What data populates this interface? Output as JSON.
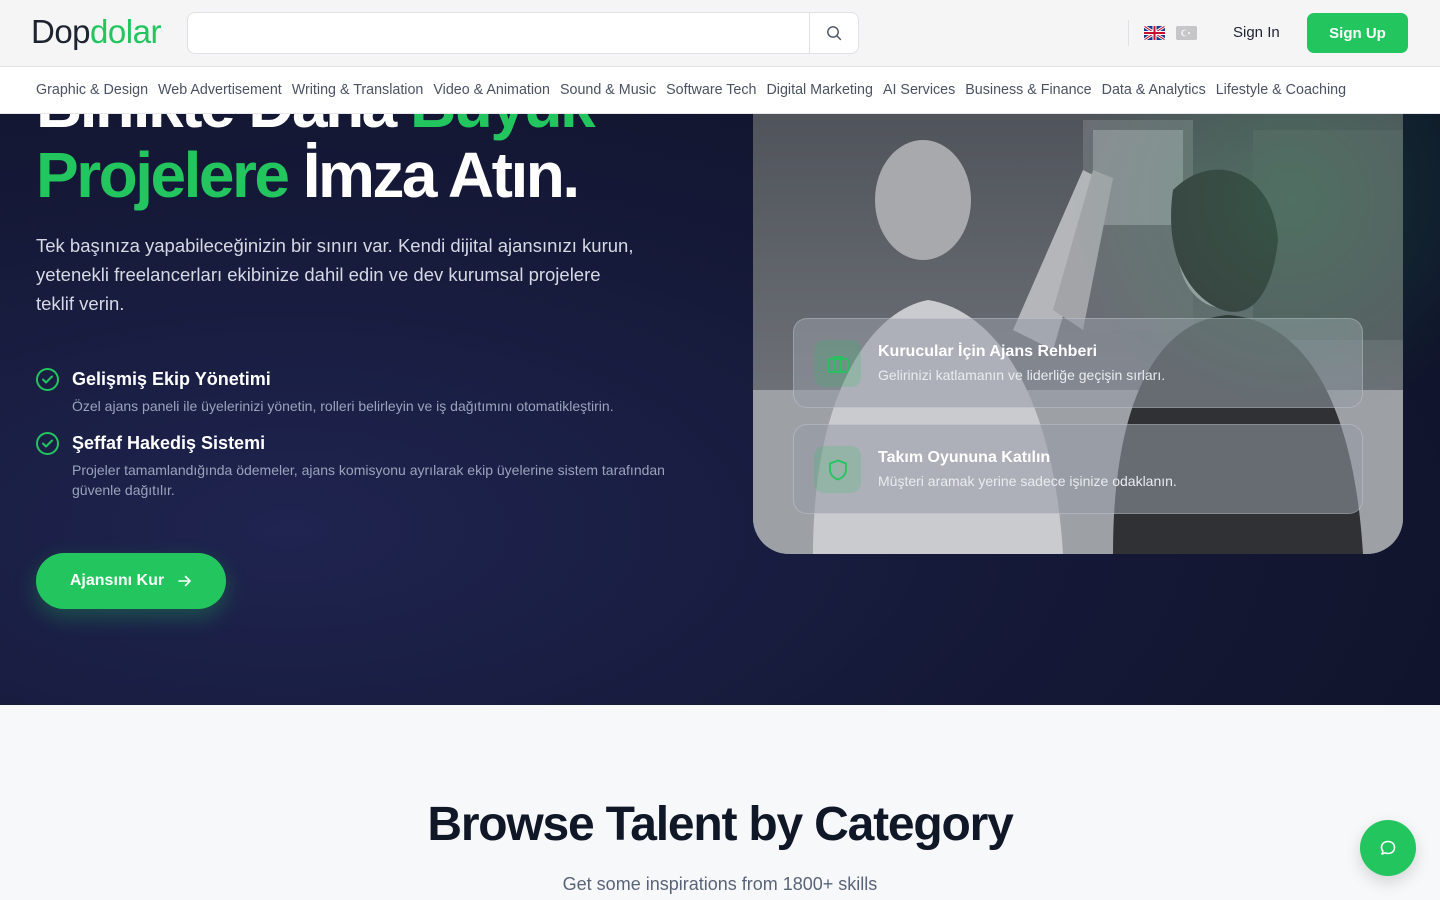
{
  "brand": {
    "part1": "Dop",
    "part2": "dolar"
  },
  "search": {
    "placeholder": "",
    "value": ""
  },
  "header": {
    "sign_in": "Sign In",
    "sign_up": "Sign Up"
  },
  "categories": [
    "Graphic & Design",
    "Web Advertisement",
    "Writing & Translation",
    "Video & Animation",
    "Sound & Music",
    "Software Tech",
    "Digital Marketing",
    "AI Services",
    "Business & Finance",
    "Data & Analytics",
    "Lifestyle & Coaching"
  ],
  "hero": {
    "title_line1_white": "Birlikte Daha ",
    "title_line1_green": "Büyük",
    "title_line2_green": "Projelere ",
    "title_line2_white": "İmza Atın.",
    "description": "Tek başınıza yapabileceğinizin bir sınırı var. Kendi dijital ajansınızı kurun, yetenekli freelancerları ekibinize dahil edin ve dev kurumsal projelere teklif verin.",
    "features": [
      {
        "title": "Gelişmiş Ekip Yönetimi",
        "text": "Özel ajans paneli ile üyelerinizi yönetin, rolleri belirleyin ve iş dağıtımını otomatikleştirin."
      },
      {
        "title": "Şeffaf Hakediş Sistemi",
        "text": "Projeler tamamlandığında ödemeler, ajans komisyonu ayrılarak ekip üyelerine sistem tarafından güvenle dağıtılır."
      }
    ],
    "cta": "Ajansını Kur",
    "cards": [
      {
        "title": "Kurucular İçin Ajans Rehberi",
        "text": "Gelirinizi katlamanın ve liderliğe geçişin sırları."
      },
      {
        "title": "Takım Oyununa Katılın",
        "text": "Müşteri aramak yerine sadece işinize odaklanın."
      }
    ]
  },
  "section": {
    "title": "Browse Talent by Category",
    "subtitle": "Get some inspirations from 1800+ skills"
  },
  "colors": {
    "accent": "#22c55e",
    "hero_bg": "#11162f",
    "text_dark": "#101828"
  }
}
